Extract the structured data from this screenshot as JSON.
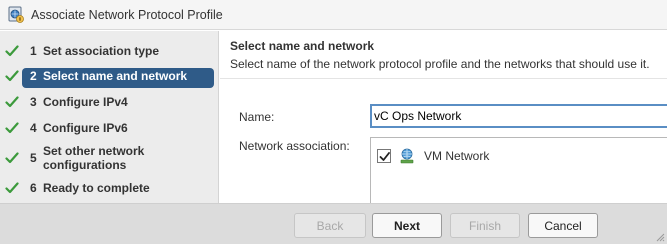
{
  "window": {
    "title": "Associate Network Protocol Profile",
    "icon": "network-protocol-profile-icon"
  },
  "steps": [
    {
      "number": "1",
      "label": "Set association type",
      "completed": true,
      "active": false
    },
    {
      "number": "2",
      "label": "Select name and network",
      "completed": true,
      "active": true
    },
    {
      "number": "3",
      "label": "Configure IPv4",
      "completed": true,
      "active": false
    },
    {
      "number": "4",
      "label": "Configure IPv6",
      "completed": true,
      "active": false
    },
    {
      "number": "5",
      "label_line1": "Set other network",
      "label_line2": "configurations",
      "completed": true,
      "active": false
    },
    {
      "number": "6",
      "label": "Ready to complete",
      "completed": true,
      "active": false
    }
  ],
  "main": {
    "title": "Select name and network",
    "description": "Select name of the network protocol profile and the networks that should use it.",
    "name_label": "Name:",
    "name_value": "vC Ops Network",
    "association_label": "Network association:",
    "networks": [
      {
        "label": "VM Network",
        "checked": true
      }
    ]
  },
  "footer": {
    "back_label": "Back",
    "next_label": "Next",
    "finish_label": "Finish",
    "cancel_label": "Cancel"
  },
  "colors": {
    "check_green": "#3c9a3c",
    "active_step_bg": "#2f5b88",
    "input_focus_border": "#5a8ec4"
  }
}
